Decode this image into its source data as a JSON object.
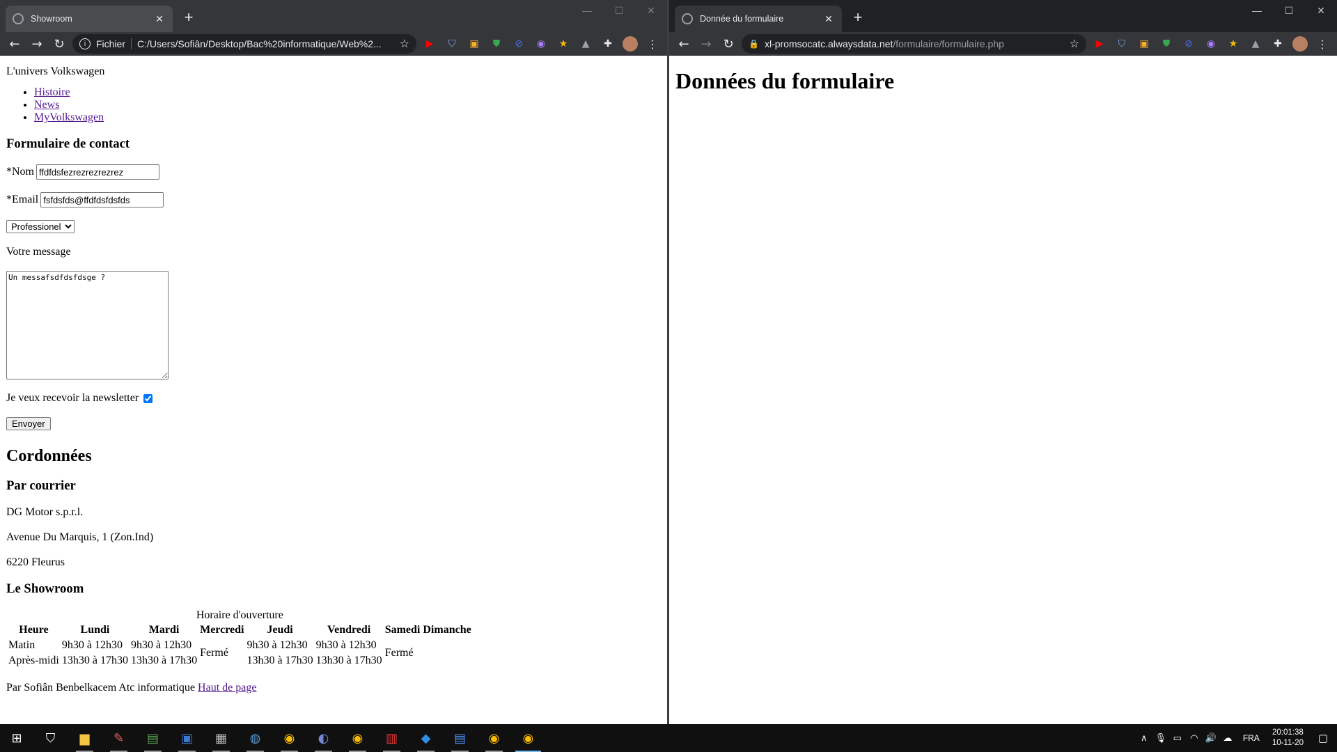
{
  "left_window": {
    "tab_title": "Showroom",
    "tab_close": "✕",
    "new_tab": "+",
    "scheme_label": "Fichier",
    "url": "C:/Users/Sofiân/Desktop/Bac%20informatique/Web%2...",
    "page": {
      "site_title": "L'univers Volkswagen",
      "nav": [
        "Histoire",
        "News",
        "MyVolkswagen"
      ],
      "form_heading": "Formulaire de contact",
      "name_label": "*Nom",
      "name_value": "ffdfdsfezrezrezrezrez",
      "email_label": "*Email",
      "email_value": "fsfdsfds@ffdfdsfdsfds",
      "select_value": "Professionel",
      "message_label": "Votre message",
      "message_value": "Un messafsdfdsfdsge ?",
      "newsletter_label": "Je veux recevoir la newsletter",
      "newsletter_checked": true,
      "submit_label": "Envoyer",
      "contact_heading": "Cordonnées",
      "mail_heading": "Par courrier",
      "address": [
        "DG Motor s.p.r.l.",
        "Avenue Du Marquis, 1 (Zon.Ind)",
        "6220 Fleurus"
      ],
      "showroom_heading": "Le Showroom",
      "table": {
        "caption": "Horaire d'ouverture",
        "headers": [
          "Heure",
          "Lundi",
          "Mardi",
          "Mercredi",
          "Jeudi",
          "Vendredi",
          "Samedi",
          "Dimanche"
        ],
        "rows": [
          [
            "Matin",
            "9h30 à 12h30",
            "9h30 à 12h30",
            "Fermé",
            "9h30 à 12h30",
            "9h30 à 12h30",
            "Fermé"
          ],
          [
            "Après-midi",
            "13h30 à 17h30",
            "13h30 à 17h30",
            "13h30 à 17h30",
            "13h30 à 17h30"
          ]
        ]
      },
      "footer_text": "Par Sofiân Benbelkacem Atc informatique",
      "footer_link": "Haut de page"
    }
  },
  "right_window": {
    "tab_title": "Donnée du formulaire",
    "tab_close": "✕",
    "new_tab": "+",
    "url_host": "xl-promsocatc.alwaysdata.net",
    "url_path": "/formulaire/formulaire.php",
    "page_heading": "Données du formulaire"
  },
  "taskbar": {
    "language": "FRA",
    "time": "20:01:38",
    "date": "10-11-20"
  },
  "icons": {
    "back": "←",
    "forward": "→",
    "reload": "↻",
    "star": "☆",
    "menu": "⋮",
    "minimize": "—",
    "maximize": "☐",
    "close": "✕"
  },
  "colors": {
    "chrome_dark": "#202124",
    "chrome_toolbar": "#35363a",
    "visited_link": "#551a8b",
    "taskbar": "#101010"
  }
}
